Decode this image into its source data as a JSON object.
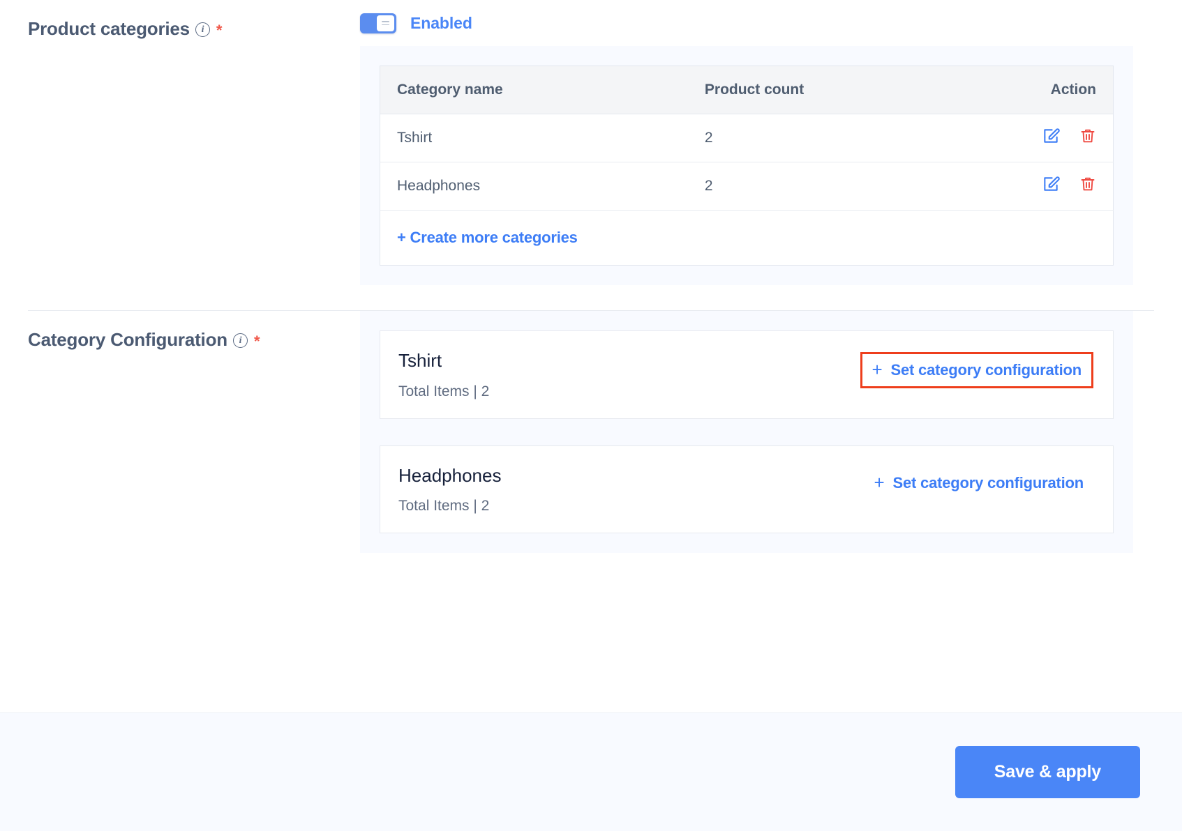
{
  "product_categories": {
    "title": "Product categories",
    "info_icon": "info-icon",
    "required_marker": "*",
    "toggle": {
      "state_label": "Enabled",
      "enabled": true,
      "accent_color": "#5b8def"
    },
    "table": {
      "columns": [
        "Category name",
        "Product count",
        "Action"
      ],
      "rows": [
        {
          "name": "Tshirt",
          "count": "2",
          "edit_icon": "edit-pencil-icon",
          "delete_icon": "trash-icon"
        },
        {
          "name": "Headphones",
          "count": "2",
          "edit_icon": "edit-pencil-icon",
          "delete_icon": "trash-icon"
        }
      ],
      "create_link": "+ Create more categories",
      "edit_color": "#3d7df6",
      "delete_color": "#ef4a42"
    }
  },
  "category_configuration": {
    "title": "Category Configuration",
    "info_icon": "info-icon",
    "required_marker": "*",
    "cards": [
      {
        "name": "Tshirt",
        "meta": "Total Items | 2",
        "action_label": "Set category configuration",
        "action_plus": "+",
        "highlighted": true,
        "highlight_color": "#ee3e1c"
      },
      {
        "name": "Headphones",
        "meta": "Total Items | 2",
        "action_label": "Set category configuration",
        "action_plus": "+",
        "highlighted": false,
        "highlight_color": "#ee3e1c"
      }
    ]
  },
  "footer": {
    "save_label": "Save & apply",
    "save_color": "#4a86f7"
  }
}
